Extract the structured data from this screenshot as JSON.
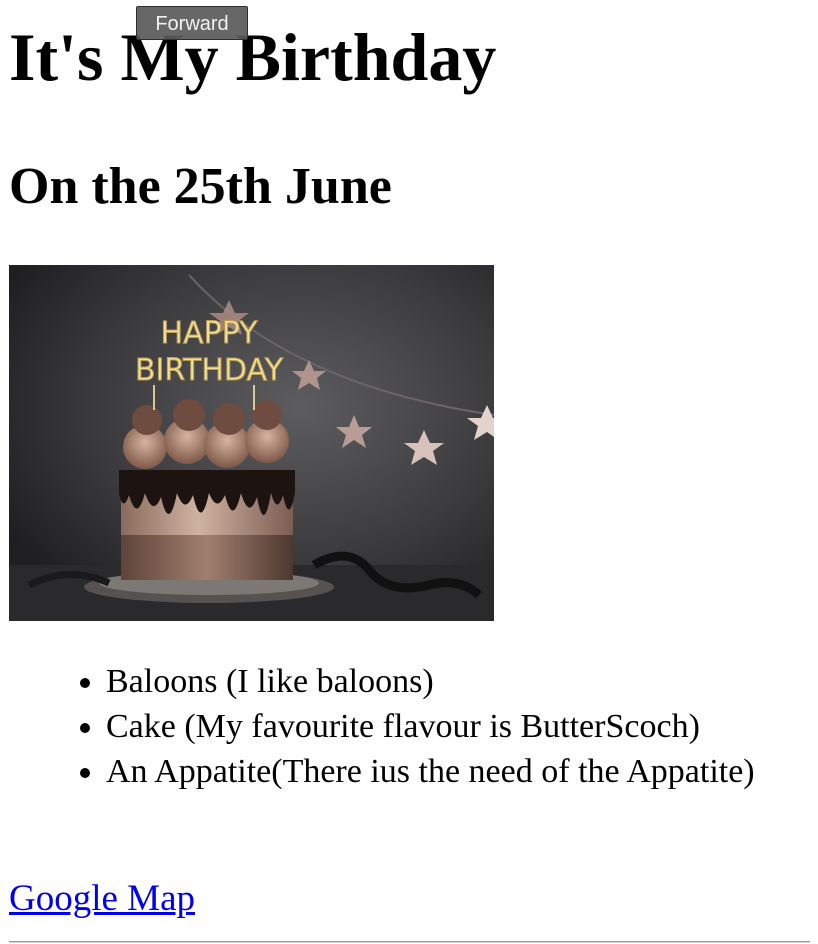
{
  "heading": {
    "title": "It's My Birthday",
    "subtitle": "On the 25th June"
  },
  "image": {
    "topper_text_line1": "HAPPY",
    "topper_text_line2": "BIRTHDAY"
  },
  "wishlist": {
    "items": [
      "Baloons (I like baloons)",
      "Cake (My favourite flavour is ButterScoch)",
      "An Appatite(There ius the need of the Appatite)"
    ]
  },
  "link": {
    "label": "Google Map",
    "color": "#0000ee"
  },
  "tooltip": {
    "label": "Forward"
  }
}
